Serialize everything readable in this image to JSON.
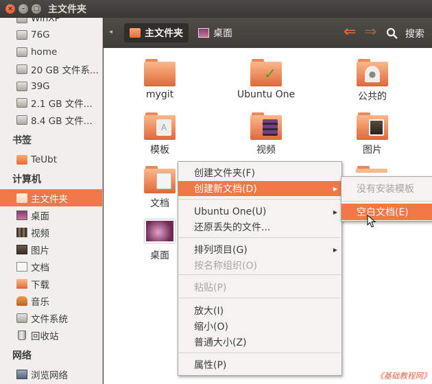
{
  "window": {
    "title": "主文件夹"
  },
  "sidebar": {
    "devices": [
      {
        "label": "WinXP",
        "icon": "drive-icon"
      },
      {
        "label": "76G",
        "icon": "drive-icon"
      },
      {
        "label": "home",
        "icon": "drive-icon"
      },
      {
        "label": "20 GB 文件系...",
        "icon": "drive-icon"
      },
      {
        "label": "39G",
        "icon": "drive-icon"
      },
      {
        "label": "2.1 GB 文件...",
        "icon": "drive-icon"
      },
      {
        "label": "8.4 GB 文件...",
        "icon": "drive-icon"
      }
    ],
    "bookmarks_heading": "书签",
    "bookmarks": [
      {
        "label": "TeUbt",
        "icon": "folder-icon"
      }
    ],
    "computer_heading": "计算机",
    "computer": [
      {
        "label": "主文件夹",
        "icon": "home-folder-icon",
        "selected": true
      },
      {
        "label": "桌面",
        "icon": "desktop-icon"
      },
      {
        "label": "视频",
        "icon": "videos-icon"
      },
      {
        "label": "图片",
        "icon": "pictures-icon"
      },
      {
        "label": "文档",
        "icon": "documents-icon"
      },
      {
        "label": "下载",
        "icon": "downloads-icon"
      },
      {
        "label": "音乐",
        "icon": "music-icon"
      },
      {
        "label": "文件系统",
        "icon": "filesystem-icon"
      },
      {
        "label": "回收站",
        "icon": "trash-icon"
      }
    ],
    "network_heading": "网络",
    "network": [
      {
        "label": "浏览网络",
        "icon": "network-icon"
      }
    ]
  },
  "toolbar": {
    "crumbs": [
      {
        "label": "主文件夹",
        "active": true
      },
      {
        "label": "桌面",
        "active": false
      }
    ],
    "back_icon": "back-arrow-icon",
    "forward_icon": "forward-arrow-icon",
    "search_label": "搜索"
  },
  "files": [
    {
      "label": "mygit",
      "icon": "folder-icon"
    },
    {
      "label": "Ubuntu One",
      "icon": "ubuntu-one-folder-icon"
    },
    {
      "label": "公共的",
      "icon": "public-folder-icon"
    },
    {
      "label": "模板",
      "icon": "templates-folder-icon"
    },
    {
      "label": "视频",
      "icon": "videos-folder-icon"
    },
    {
      "label": "图片",
      "icon": "pictures-folder-icon"
    },
    {
      "label": "文档",
      "icon": "documents-folder-icon"
    },
    {
      "label": "桌面",
      "icon": "desktop-thumbnail-icon"
    }
  ],
  "context_menu": {
    "items": [
      {
        "label": "创建文件夹(F)",
        "state": "normal"
      },
      {
        "label": "创建新文档(D)",
        "state": "highlighted",
        "submenu": true
      },
      {
        "label": "Ubuntu One(U)",
        "state": "normal",
        "submenu": true
      },
      {
        "label": "还原丢失的文件...",
        "state": "normal"
      },
      {
        "label": "排列项目(G)",
        "state": "normal",
        "submenu": true
      },
      {
        "label": "按名称组织(O)",
        "state": "disabled"
      },
      {
        "label": "粘贴(P)",
        "state": "disabled"
      },
      {
        "label": "放大(I)",
        "state": "normal"
      },
      {
        "label": "缩小(O)",
        "state": "normal"
      },
      {
        "label": "普通大小(Z)",
        "state": "normal"
      },
      {
        "label": "属性(P)",
        "state": "normal"
      }
    ]
  },
  "submenu": {
    "items": [
      {
        "label": "没有安装模板",
        "state": "disabled"
      },
      {
        "label": "空白文档(E)",
        "state": "highlighted"
      }
    ]
  },
  "watermark": "《基础教程网》",
  "colors": {
    "accent": "#f07746",
    "toolbar": "#3e3d39",
    "sidebar": "#f0efec"
  }
}
